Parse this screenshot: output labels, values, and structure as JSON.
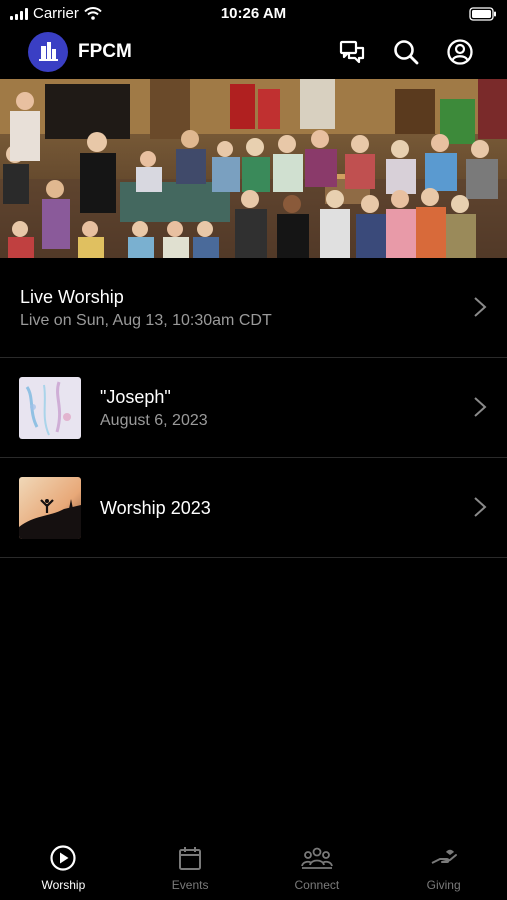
{
  "status_bar": {
    "carrier": "Carrier",
    "time": "10:26 AM"
  },
  "header": {
    "app_title": "FPCM",
    "icons": [
      "chat-icon",
      "search-icon",
      "profile-icon"
    ]
  },
  "items": [
    {
      "title": "Live Worship",
      "subtitle": "Live on Sun, Aug 13, 10:30am CDT"
    },
    {
      "title": "\"Joseph\"",
      "subtitle": "August 6, 2023"
    },
    {
      "title": "Worship 2023"
    }
  ],
  "tabbar": {
    "tabs": [
      {
        "label": "Worship",
        "icon": "play-circle-icon",
        "active": true
      },
      {
        "label": "Events",
        "icon": "calendar-icon"
      },
      {
        "label": "Connect",
        "icon": "people-icon"
      },
      {
        "label": "Giving",
        "icon": "giving-hand-icon"
      }
    ]
  },
  "colors": {
    "background": "#000000",
    "logo": "#3a3fc4",
    "secondary_text": "#9a9a9a",
    "inactive_tab": "#7a7a7a"
  }
}
